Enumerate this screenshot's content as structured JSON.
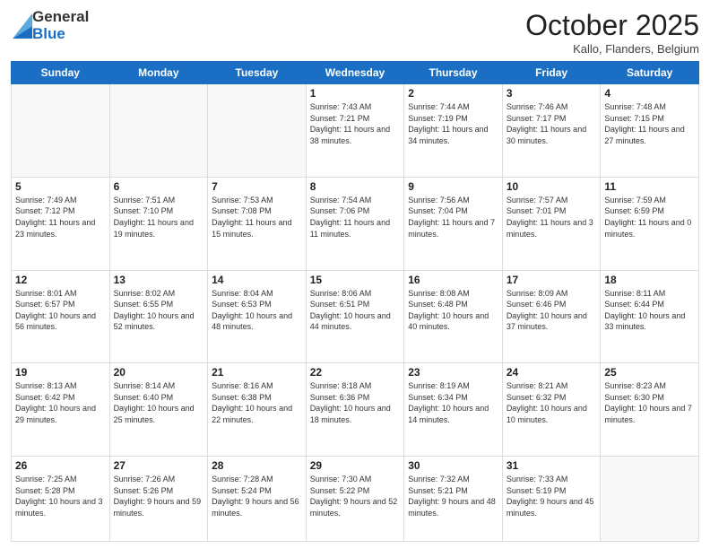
{
  "header": {
    "logo": {
      "general": "General",
      "blue": "Blue"
    },
    "title": "October 2025",
    "location": "Kallo, Flanders, Belgium"
  },
  "weekdays": [
    "Sunday",
    "Monday",
    "Tuesday",
    "Wednesday",
    "Thursday",
    "Friday",
    "Saturday"
  ],
  "weeks": [
    [
      {
        "day": "",
        "sunrise": "",
        "sunset": "",
        "daylight": ""
      },
      {
        "day": "",
        "sunrise": "",
        "sunset": "",
        "daylight": ""
      },
      {
        "day": "",
        "sunrise": "",
        "sunset": "",
        "daylight": ""
      },
      {
        "day": "1",
        "sunrise": "Sunrise: 7:43 AM",
        "sunset": "Sunset: 7:21 PM",
        "daylight": "Daylight: 11 hours and 38 minutes."
      },
      {
        "day": "2",
        "sunrise": "Sunrise: 7:44 AM",
        "sunset": "Sunset: 7:19 PM",
        "daylight": "Daylight: 11 hours and 34 minutes."
      },
      {
        "day": "3",
        "sunrise": "Sunrise: 7:46 AM",
        "sunset": "Sunset: 7:17 PM",
        "daylight": "Daylight: 11 hours and 30 minutes."
      },
      {
        "day": "4",
        "sunrise": "Sunrise: 7:48 AM",
        "sunset": "Sunset: 7:15 PM",
        "daylight": "Daylight: 11 hours and 27 minutes."
      }
    ],
    [
      {
        "day": "5",
        "sunrise": "Sunrise: 7:49 AM",
        "sunset": "Sunset: 7:12 PM",
        "daylight": "Daylight: 11 hours and 23 minutes."
      },
      {
        "day": "6",
        "sunrise": "Sunrise: 7:51 AM",
        "sunset": "Sunset: 7:10 PM",
        "daylight": "Daylight: 11 hours and 19 minutes."
      },
      {
        "day": "7",
        "sunrise": "Sunrise: 7:53 AM",
        "sunset": "Sunset: 7:08 PM",
        "daylight": "Daylight: 11 hours and 15 minutes."
      },
      {
        "day": "8",
        "sunrise": "Sunrise: 7:54 AM",
        "sunset": "Sunset: 7:06 PM",
        "daylight": "Daylight: 11 hours and 11 minutes."
      },
      {
        "day": "9",
        "sunrise": "Sunrise: 7:56 AM",
        "sunset": "Sunset: 7:04 PM",
        "daylight": "Daylight: 11 hours and 7 minutes."
      },
      {
        "day": "10",
        "sunrise": "Sunrise: 7:57 AM",
        "sunset": "Sunset: 7:01 PM",
        "daylight": "Daylight: 11 hours and 3 minutes."
      },
      {
        "day": "11",
        "sunrise": "Sunrise: 7:59 AM",
        "sunset": "Sunset: 6:59 PM",
        "daylight": "Daylight: 11 hours and 0 minutes."
      }
    ],
    [
      {
        "day": "12",
        "sunrise": "Sunrise: 8:01 AM",
        "sunset": "Sunset: 6:57 PM",
        "daylight": "Daylight: 10 hours and 56 minutes."
      },
      {
        "day": "13",
        "sunrise": "Sunrise: 8:02 AM",
        "sunset": "Sunset: 6:55 PM",
        "daylight": "Daylight: 10 hours and 52 minutes."
      },
      {
        "day": "14",
        "sunrise": "Sunrise: 8:04 AM",
        "sunset": "Sunset: 6:53 PM",
        "daylight": "Daylight: 10 hours and 48 minutes."
      },
      {
        "day": "15",
        "sunrise": "Sunrise: 8:06 AM",
        "sunset": "Sunset: 6:51 PM",
        "daylight": "Daylight: 10 hours and 44 minutes."
      },
      {
        "day": "16",
        "sunrise": "Sunrise: 8:08 AM",
        "sunset": "Sunset: 6:48 PM",
        "daylight": "Daylight: 10 hours and 40 minutes."
      },
      {
        "day": "17",
        "sunrise": "Sunrise: 8:09 AM",
        "sunset": "Sunset: 6:46 PM",
        "daylight": "Daylight: 10 hours and 37 minutes."
      },
      {
        "day": "18",
        "sunrise": "Sunrise: 8:11 AM",
        "sunset": "Sunset: 6:44 PM",
        "daylight": "Daylight: 10 hours and 33 minutes."
      }
    ],
    [
      {
        "day": "19",
        "sunrise": "Sunrise: 8:13 AM",
        "sunset": "Sunset: 6:42 PM",
        "daylight": "Daylight: 10 hours and 29 minutes."
      },
      {
        "day": "20",
        "sunrise": "Sunrise: 8:14 AM",
        "sunset": "Sunset: 6:40 PM",
        "daylight": "Daylight: 10 hours and 25 minutes."
      },
      {
        "day": "21",
        "sunrise": "Sunrise: 8:16 AM",
        "sunset": "Sunset: 6:38 PM",
        "daylight": "Daylight: 10 hours and 22 minutes."
      },
      {
        "day": "22",
        "sunrise": "Sunrise: 8:18 AM",
        "sunset": "Sunset: 6:36 PM",
        "daylight": "Daylight: 10 hours and 18 minutes."
      },
      {
        "day": "23",
        "sunrise": "Sunrise: 8:19 AM",
        "sunset": "Sunset: 6:34 PM",
        "daylight": "Daylight: 10 hours and 14 minutes."
      },
      {
        "day": "24",
        "sunrise": "Sunrise: 8:21 AM",
        "sunset": "Sunset: 6:32 PM",
        "daylight": "Daylight: 10 hours and 10 minutes."
      },
      {
        "day": "25",
        "sunrise": "Sunrise: 8:23 AM",
        "sunset": "Sunset: 6:30 PM",
        "daylight": "Daylight: 10 hours and 7 minutes."
      }
    ],
    [
      {
        "day": "26",
        "sunrise": "Sunrise: 7:25 AM",
        "sunset": "Sunset: 5:28 PM",
        "daylight": "Daylight: 10 hours and 3 minutes."
      },
      {
        "day": "27",
        "sunrise": "Sunrise: 7:26 AM",
        "sunset": "Sunset: 5:26 PM",
        "daylight": "Daylight: 9 hours and 59 minutes."
      },
      {
        "day": "28",
        "sunrise": "Sunrise: 7:28 AM",
        "sunset": "Sunset: 5:24 PM",
        "daylight": "Daylight: 9 hours and 56 minutes."
      },
      {
        "day": "29",
        "sunrise": "Sunrise: 7:30 AM",
        "sunset": "Sunset: 5:22 PM",
        "daylight": "Daylight: 9 hours and 52 minutes."
      },
      {
        "day": "30",
        "sunrise": "Sunrise: 7:32 AM",
        "sunset": "Sunset: 5:21 PM",
        "daylight": "Daylight: 9 hours and 48 minutes."
      },
      {
        "day": "31",
        "sunrise": "Sunrise: 7:33 AM",
        "sunset": "Sunset: 5:19 PM",
        "daylight": "Daylight: 9 hours and 45 minutes."
      },
      {
        "day": "",
        "sunrise": "",
        "sunset": "",
        "daylight": ""
      }
    ]
  ]
}
